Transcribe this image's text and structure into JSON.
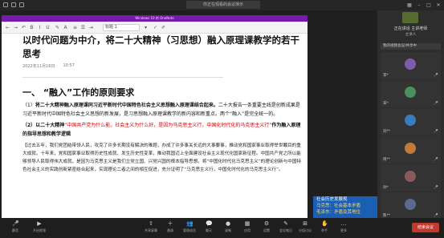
{
  "meeting": {
    "title": "你正在观看的会议演示"
  },
  "onenote": {
    "window_title": "Windows 10 的 OneNote",
    "toolbar": {
      "style_value": "标题 1"
    }
  },
  "document": {
    "title": "以时代问题为中介，将二十大精神（习思想）融入原理课教学的若干思考",
    "date": "2022年11月16日",
    "time": "10:57",
    "section1": "一、 “融入”工作的原则要求",
    "p1_prefix": "（1）",
    "p1_bold": "将二十大精神融入原理课同习近平新时代中国特色社会主义思想融入原理课结合起来。",
    "p1_rest": "二十大报告一条重要主线是创新成果是习近平新时代中国特色社会主义思想的新发展，是习思想融入原理课教学的新内容和新重点。两个“融入”是完全统一的。",
    "p2_prefix": "（2）",
    "p2_bold": "以二十大精神",
    "p2_red": "“中国共产党为什么能，社会主义为什么好，是因为马克思主义行，中国化时代化的马克思主义行”",
    "p2_rest": "作为融入原理的指导思想和教学逻辑",
    "p3": "【过去五年，我们党团结带领人民，攻克了许多长期没有解决的难题，办成了许多事关长远的大事要事，推动党和国家事业取得举世瞩目的重大成就。十年来，党和国家事业取得历史性成就、发生历史性变革，推动我国迈上全面建设社会主义现代化国家新征程。中国共产党之所以能够领导人民取得伟大成就，是因为马克思主义是我们立党立国、兴党兴国的根本指导思想。将“中国化时代化马克思主义”的理论创新与中国特色社会主义的实践创新紧密结合起来，实现理论二者之间的相互促进，充分证明了“马克思主义行，中国化时代化的马克思主义行”。"
  },
  "overlay": {
    "line1": "社会历史发展规",
    "line2": "马克思：社会基本矛盾",
    "line3": "毛泽东：矛盾及其地位"
  },
  "panel": {
    "host_name": "正在讲话 主讲老师",
    "host_sub": "主讲人",
    "note": "我的视频会议/共享中",
    "participants": [
      {
        "name": "李*",
        "mic": "🎤",
        "color": "#7b5ea7"
      },
      {
        "name": "宋*",
        "mic": "🎤",
        "color": "#4a8f5c"
      },
      {
        "name": "刘**",
        "mic": "🎤",
        "color": "#3b7bbf"
      },
      {
        "name": "周**",
        "mic": "🎤",
        "color": "#c07a3a"
      },
      {
        "name": "孙*",
        "mic": "🎤",
        "color": "#8a5a5a"
      },
      {
        "name": "陈**",
        "mic": "🎤",
        "color": "#5a6a8a"
      }
    ]
  },
  "bottombar": {
    "items": [
      {
        "label": "静音",
        "icon": "🎤"
      },
      {
        "label": "开启视频",
        "icon": "▶"
      },
      {
        "label": "共享屏幕",
        "icon": "⇧"
      },
      {
        "label": "邀请",
        "icon": "＋"
      },
      {
        "label": "管理成员",
        "icon": "👥"
      },
      {
        "label": "聊天",
        "icon": "💬"
      },
      {
        "label": "录制",
        "icon": "●"
      },
      {
        "label": "应用",
        "icon": "▦"
      },
      {
        "label": "设置",
        "icon": "⚙"
      },
      {
        "label": "会议笔记",
        "icon": "✎"
      },
      {
        "label": "分组讨论",
        "icon": "⊞"
      },
      {
        "label": "举手",
        "icon": "✋"
      },
      {
        "label": "更多",
        "icon": "…"
      }
    ],
    "end_label": "结束会议"
  }
}
